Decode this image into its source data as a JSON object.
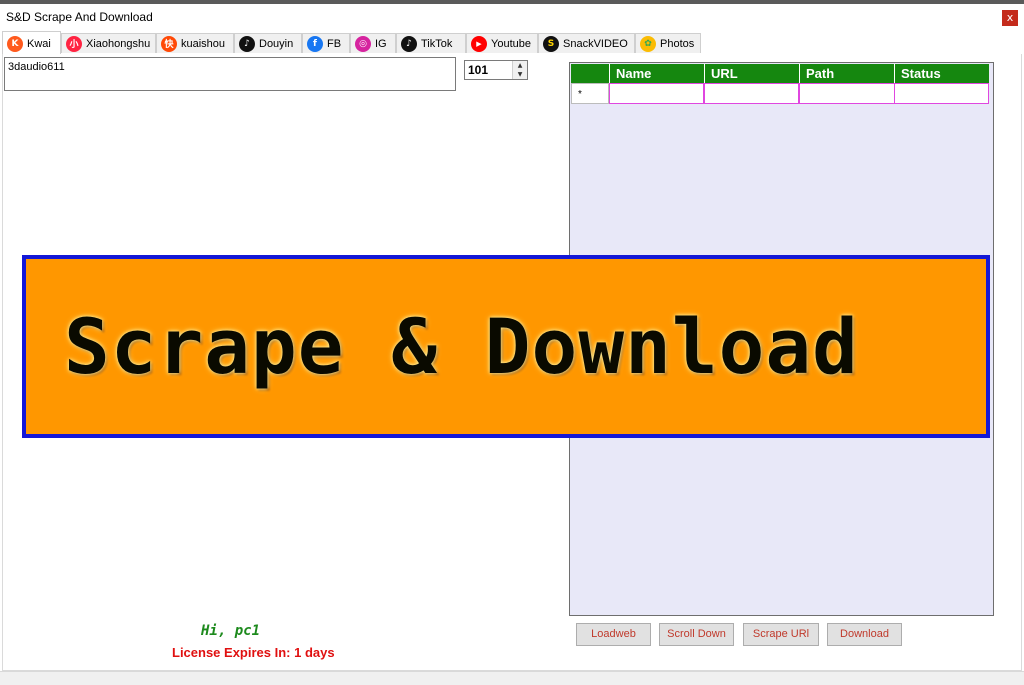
{
  "window": {
    "title": "S&D Scrape And Download",
    "close_label": "x"
  },
  "tabs": [
    {
      "label": "Kwai",
      "icon": "kwai-icon",
      "color": "#ff5a1e",
      "glyph": "K"
    },
    {
      "label": "Xiaohongshu",
      "icon": "xiaohongshu-icon",
      "color": "#ff2442",
      "glyph": "小"
    },
    {
      "label": "kuaishou",
      "icon": "kuaishou-icon",
      "color": "#ff4906",
      "glyph": "快"
    },
    {
      "label": "Douyin",
      "icon": "douyin-icon",
      "color": "#111111",
      "glyph": "♪"
    },
    {
      "label": "FB",
      "icon": "facebook-icon",
      "color": "#1877f2",
      "glyph": "f"
    },
    {
      "label": "IG",
      "icon": "instagram-icon",
      "color": "#d6249f",
      "glyph": "◎"
    },
    {
      "label": "TikTok",
      "icon": "tiktok-icon",
      "color": "#111111",
      "glyph": "♪"
    },
    {
      "label": "Youtube",
      "icon": "youtube-icon",
      "color": "#ff0000",
      "glyph": "▶"
    },
    {
      "label": "SnackVIDEO",
      "icon": "snackvideo-icon",
      "color": "#111111",
      "glyph": "S"
    },
    {
      "label": "Photos",
      "icon": "photos-icon",
      "color": "#fbbc04",
      "glyph": "✿"
    }
  ],
  "input": {
    "value": "3daudio611"
  },
  "spinner": {
    "value": "101",
    "up": "▲",
    "down": "▼"
  },
  "grid": {
    "columns": [
      "Name",
      "URL",
      "Path",
      "Status"
    ],
    "new_row_marker": "*",
    "header_color": "#15870f"
  },
  "banner": {
    "text": "Scrape & Download"
  },
  "greeting": "Hi, pc1",
  "license": "License Expires In: 1 days",
  "buttons": {
    "loadweb": "Loadweb",
    "scroll_down": "Scroll Down",
    "scrape_url": "Scrape URl",
    "download": "Download"
  }
}
